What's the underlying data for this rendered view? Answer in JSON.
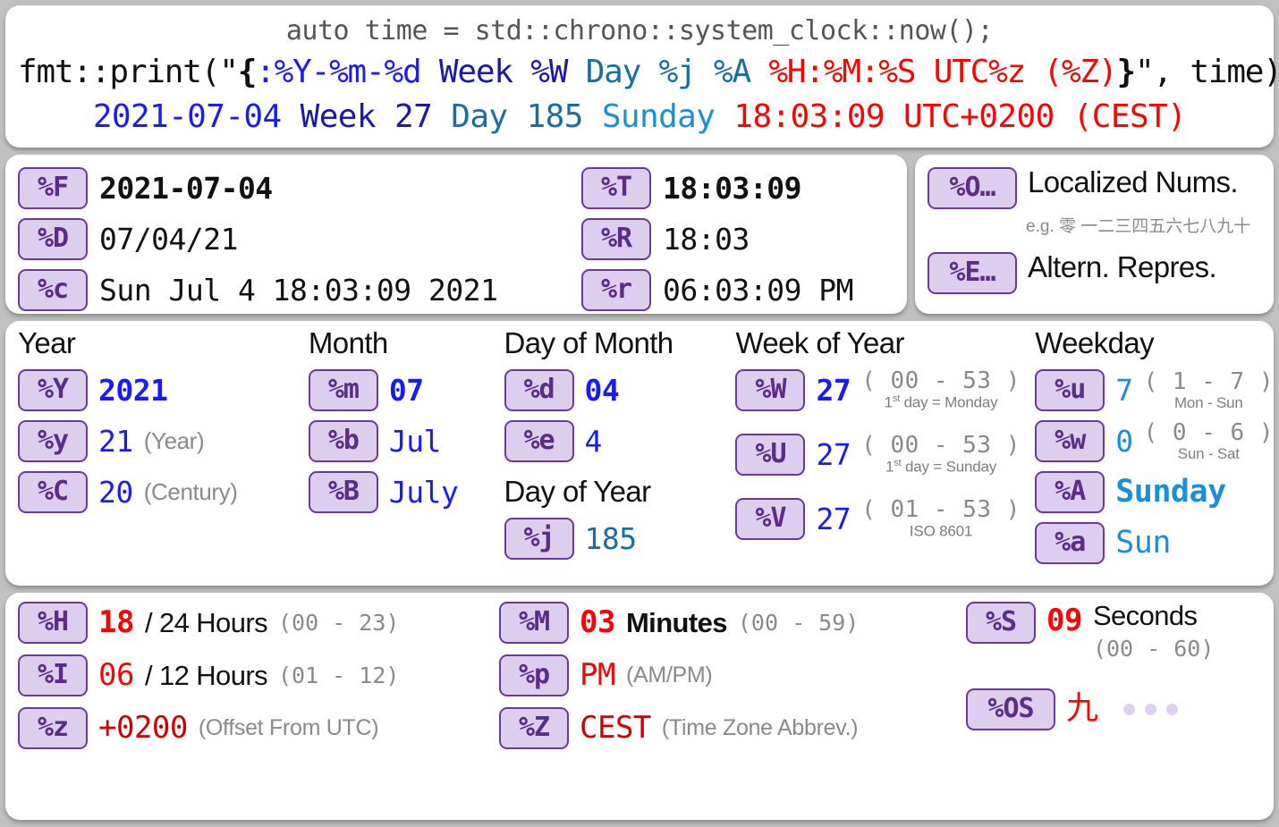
{
  "header": {
    "comment": "auto time = std::chrono::system_clock::now();",
    "call": {
      "prefix": "fmt::print(\"",
      "brace_open": "{",
      "date_spec": ":%Y-%m-%d",
      "week_spec": " Week %W",
      "day_spec": " Day %j %A",
      "time_spec": " %H:%M:%S UTC%z (%Z)",
      "brace_close": "}",
      "suffix": "\", time)"
    },
    "output": {
      "date": "2021-07-04",
      "week": "Week 27",
      "day": "Day 185",
      "weekday": "Sunday",
      "time": "18:03:09 UTC+0200 (CEST)"
    }
  },
  "full_date_time": {
    "left": [
      {
        "tag": "%F",
        "value": "2021-07-04",
        "bold": true
      },
      {
        "tag": "%D",
        "value": "07/04/21",
        "bold": false
      },
      {
        "tag": "%c",
        "value": "Sun Jul 4 18:03:09 2021",
        "bold": false
      }
    ],
    "right": [
      {
        "tag": "%T",
        "value": "18:03:09",
        "bold": true
      },
      {
        "tag": "%R",
        "value": "18:03",
        "bold": false
      },
      {
        "tag": "%r",
        "value": "06:03:09 PM",
        "bold": false
      }
    ]
  },
  "modifiers": {
    "localized": {
      "tag": "%O…",
      "label": "Localized Nums.",
      "example": "e.g. 零 一二三四五六七八九十"
    },
    "alternate": {
      "tag": "%E…",
      "label": "Altern. Repres."
    }
  },
  "date_grid": {
    "year": {
      "heading": "Year",
      "rows": [
        {
          "tag": "%Y",
          "value": "2021",
          "bold": true,
          "note": ""
        },
        {
          "tag": "%y",
          "value": "21",
          "bold": false,
          "note": "(Year)"
        },
        {
          "tag": "%C",
          "value": "20",
          "bold": false,
          "note": "(Century)"
        }
      ]
    },
    "month": {
      "heading": "Month",
      "rows": [
        {
          "tag": "%m",
          "value": "07",
          "bold": true
        },
        {
          "tag": "%b",
          "value": "Jul",
          "bold": false
        },
        {
          "tag": "%B",
          "value": "July",
          "bold": false
        }
      ]
    },
    "day_of_month": {
      "heading": "Day of Month",
      "rows": [
        {
          "tag": "%d",
          "value": "04",
          "bold": true
        },
        {
          "tag": "%e",
          "value": "4",
          "bold": false
        }
      ]
    },
    "day_of_year": {
      "heading": "Day of Year",
      "rows": [
        {
          "tag": "%j",
          "value": "185",
          "bold": false
        }
      ]
    },
    "week_of_year": {
      "heading": "Week of Year",
      "rows": [
        {
          "tag": "%W",
          "value": "27",
          "bold": true,
          "range": "( 00 - 53 )",
          "sub_pre": "1",
          "sub_sup": "st",
          "sub_post": " day = Monday"
        },
        {
          "tag": "%U",
          "value": "27",
          "bold": false,
          "range": "( 00 - 53 )",
          "sub_pre": "1",
          "sub_sup": "st",
          "sub_post": " day = Sunday"
        },
        {
          "tag": "%V",
          "value": "27",
          "bold": false,
          "range": "( 01 - 53 )",
          "sub_pre": "",
          "sub_sup": "",
          "sub_post": "ISO 8601"
        }
      ]
    },
    "weekday": {
      "heading": "Weekday",
      "rows": [
        {
          "tag": "%u",
          "value": "7",
          "bold": false,
          "range": "( 1 - 7 )",
          "sub": "Mon - Sun"
        },
        {
          "tag": "%w",
          "value": "0",
          "bold": false,
          "range": "( 0 - 6 )",
          "sub": "Sun - Sat"
        },
        {
          "tag": "%A",
          "value": "Sunday",
          "bold": true,
          "range": "",
          "sub": ""
        },
        {
          "tag": "%a",
          "value": "Sun",
          "bold": false,
          "range": "",
          "sub": ""
        }
      ]
    }
  },
  "time_grid": {
    "col1": [
      {
        "tag": "%H",
        "value": "18",
        "bold": true,
        "label": "/ 24 Hours",
        "range": "(00 - 23)"
      },
      {
        "tag": "%I",
        "value": "06",
        "bold": false,
        "label": "/ 12 Hours",
        "range": "(01 - 12)"
      },
      {
        "tag": "%z",
        "value": "+0200",
        "bold": false,
        "label": "",
        "range": "(Offset From UTC)"
      }
    ],
    "col2": [
      {
        "tag": "%M",
        "value": "03",
        "bold": true,
        "label": "Minutes",
        "range": "(00 - 59)"
      },
      {
        "tag": "%p",
        "value": "PM",
        "bold": false,
        "label": "",
        "range": "(AM/PM)"
      },
      {
        "tag": "%Z",
        "value": "CEST",
        "bold": false,
        "label": "",
        "range": "(Time Zone Abbrev.)"
      }
    ],
    "col3": {
      "seconds": {
        "tag": "%S",
        "value": "09",
        "label": "Seconds",
        "range": "(00 - 60)"
      },
      "localized_seconds": {
        "tag": "%OS",
        "value": "九"
      }
    }
  },
  "colors": {
    "background": "#c0c0c0",
    "tag_fill": "#ddcdee",
    "tag_border": "#6b3a96",
    "tag_text": "#5b2d86",
    "blue": "#1a1aff",
    "navy": "#1a1aa8",
    "teal": "#1a6e9e",
    "cyan": "#1a8fd8",
    "red": "#ff0000",
    "dark_red": "#cc0000",
    "grey": "#8a8a8a"
  }
}
